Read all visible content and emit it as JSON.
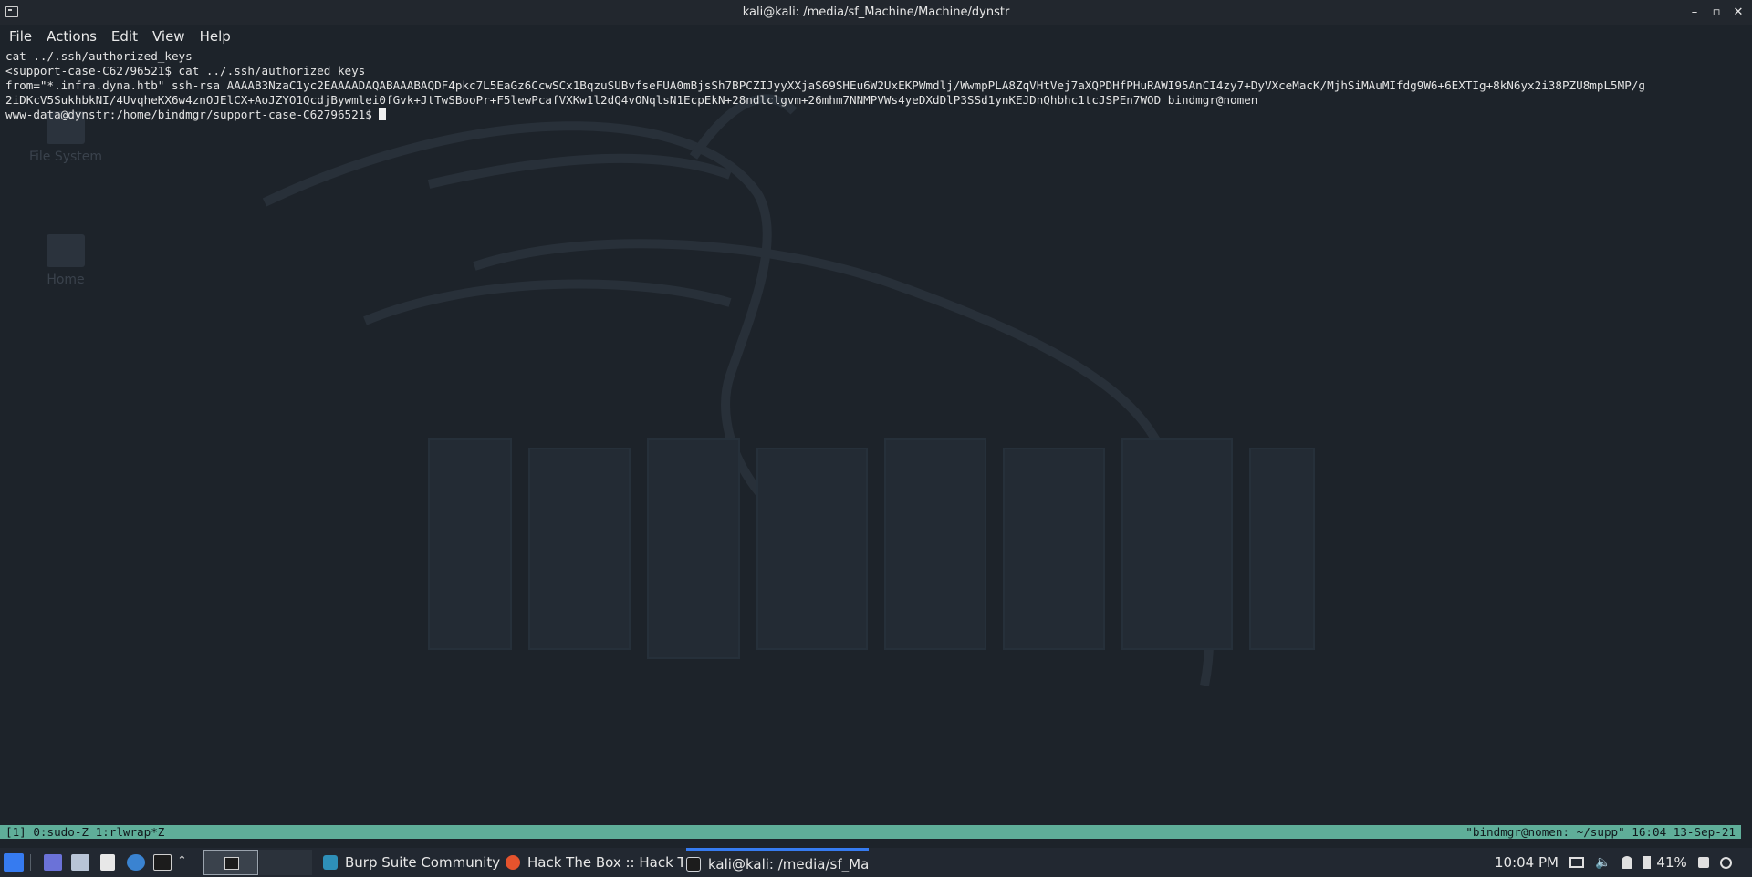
{
  "window": {
    "title": "kali@kali: /media/sf_Machine/Machine/dynstr",
    "controls": [
      "–",
      "▫",
      "✕"
    ]
  },
  "menu": [
    "File",
    "Actions",
    "Edit",
    "View",
    "Help"
  ],
  "desktop_icons": [
    "File System",
    "Home"
  ],
  "terminal": {
    "lines": [
      "cat ../.ssh/authorized_keys",
      "<support-case-C62796521$ cat ../.ssh/authorized_keys",
      "from=\"*.infra.dyna.htb\" ssh-rsa AAAAB3NzaC1yc2EAAAADAQABAAABAQDF4pkc7L5EaGz6CcwSCx1BqzuSUBvfseFUA0mBjsSh7BPCZIJyyXXjaS69SHEu6W2UxEKPWmdlj/WwmpPLA8ZqVHtVej7aXQPDHfPHuRAWI95AnCI4zy7+DyVXceMacK/MjhSiMAuMIfdg9W6+6EXTIg+8kN6yx2i38PZU8mpL5MP/g",
      "2iDKcV5SukhbkNI/4UvqheKX6w4znOJElCX+AoJZYO1QcdjBywmlei0fGvk+JtTwSBooPr+F5lewPcafVXKw1l2dQ4vONqlsN1EcpEkN+28ndlclgvm+26mhm7NNMPVWs4yeDXdDlP3SSd1ynKEJDnQhbhc1tcJSPEn7WOD bindmgr@nomen"
    ],
    "prompt": "www-data@dynstr:/home/bindmgr/support-case-C62796521$ "
  },
  "tmux": {
    "left": "[1] 0:sudo-Z 1:rlwrap*Z",
    "right": "\"bindmgr@nomen: ~/supp\" 16:04 13-Sep-21"
  },
  "taskbar": {
    "windows": [
      {
        "label": "Burp Suite Community E...",
        "icon": "burp-icon",
        "color": "#2e8fb8"
      },
      {
        "label": "Hack The Box :: Hack Th...",
        "icon": "firefox-icon",
        "color": "#e5532d"
      },
      {
        "label": "kali@kali: /media/sf_Ma...",
        "icon": "terminal-icon",
        "color": "#cfd3d8"
      }
    ],
    "clock": "10:04 PM",
    "battery": "41%"
  },
  "colors": {
    "tmux_bar": "#5fae99",
    "background": "#1d232a",
    "active_tab": "#367bf0"
  }
}
